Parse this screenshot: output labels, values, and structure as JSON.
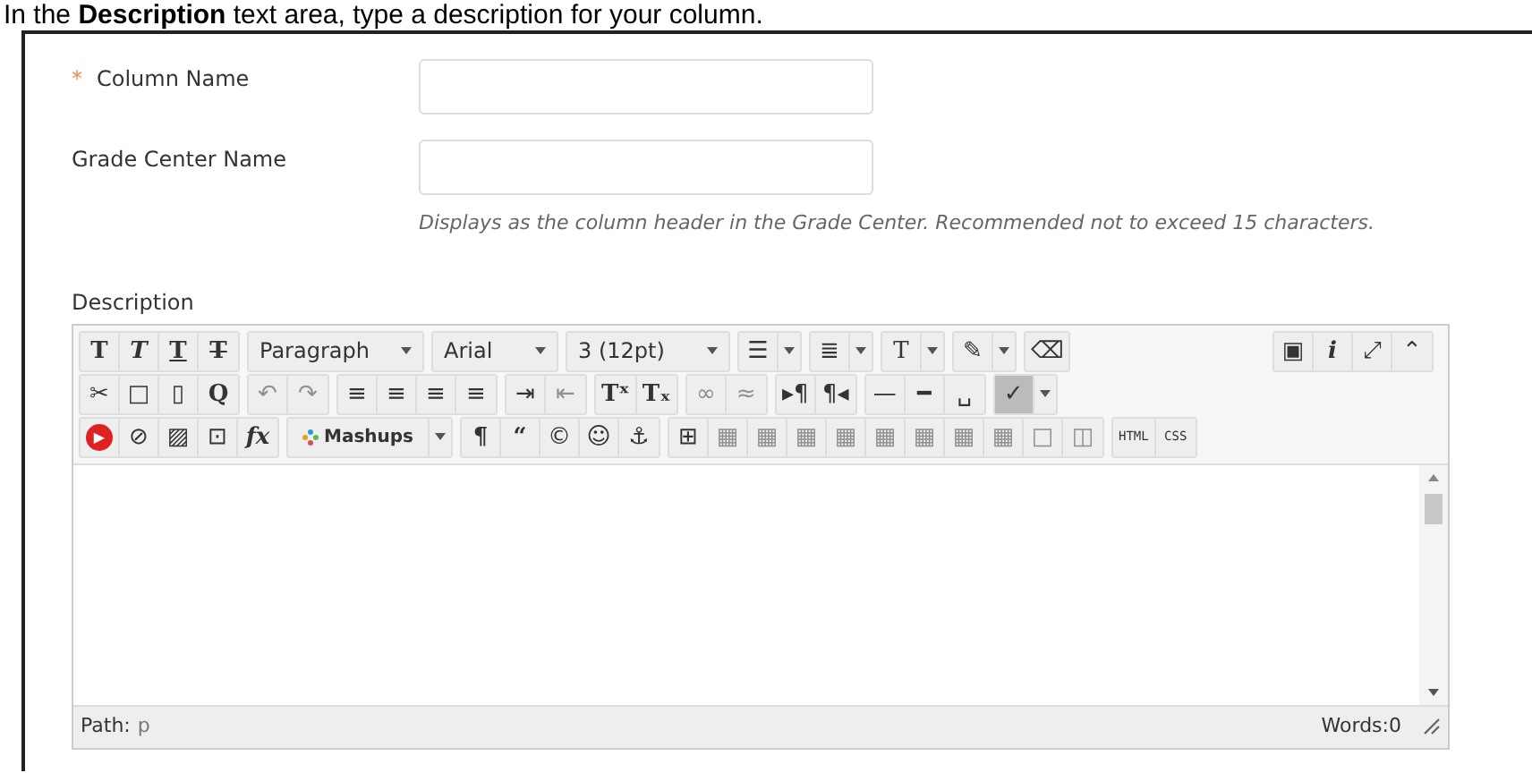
{
  "instruction": {
    "text": "In the **Description** text area, type a description for your column."
  },
  "fields": [
    {
      "marker": "*",
      "label": "Column Name"
    },
    {
      "label": "Grade Center Name",
      "hint": "Displays as the column header in the Grade Center. Recommended not to exceed 15 characters."
    }
  ],
  "description": {
    "label": "Description",
    "toolbar": [
      {
        "left": [
          [
            {
              "kind": "bold",
              "glyph": "T",
              "disabled": false
            },
            {
              "kind": "italic",
              "glyph": "T",
              "disabled": false
            },
            {
              "kind": "underline",
              "glyph": "T",
              "disabled": false
            },
            {
              "kind": "strike",
              "glyph": "T",
              "disabled": false
            }
          ],
          [
            {
              "kind": "select",
              "value": "Paragraph"
            }
          ],
          [
            {
              "kind": "select",
              "value": "Arial"
            }
          ],
          [
            {
              "kind": "select",
              "value": "3 (12pt)"
            }
          ],
          [
            {
              "kind": "split",
              "glyph": "☰",
              "disabled": false
            }
          ],
          [
            {
              "kind": "split",
              "glyph": "≣",
              "disabled": false
            }
          ],
          [
            {
              "kind": "splitserif",
              "glyph": "T",
              "disabled": false
            }
          ],
          [
            {
              "kind": "split",
              "glyph": "✎",
              "disabled": false
            }
          ],
          [
            {
              "kind": "button",
              "glyph": "⌫",
              "disabled": false
            }
          ]
        ],
        "right": [
          [
            {
              "kind": "button",
              "glyph": "▣",
              "disabled": false
            },
            {
              "kind": "italic",
              "glyph": "i",
              "disabled": false
            },
            {
              "kind": "button",
              "glyph": "⤢",
              "disabled": false
            },
            {
              "kind": "button",
              "glyph": "⌃",
              "disabled": false
            }
          ]
        ]
      },
      {
        "left": [
          [
            {
              "kind": "button",
              "glyph": "✂",
              "disabled": false
            },
            {
              "kind": "button",
              "glyph": "□",
              "disabled": false
            },
            {
              "kind": "button",
              "glyph": "▯",
              "disabled": false
            },
            {
              "kind": "bold",
              "glyph": "Q",
              "disabled": false
            }
          ],
          [
            {
              "kind": "button",
              "glyph": "↶",
              "disabled": true
            },
            {
              "kind": "button",
              "glyph": "↷",
              "disabled": true
            }
          ],
          [
            {
              "kind": "button",
              "glyph": "≡",
              "disabled": false
            },
            {
              "kind": "button",
              "glyph": "≡",
              "disabled": false
            },
            {
              "kind": "button",
              "glyph": "≡",
              "disabled": false
            },
            {
              "kind": "button",
              "glyph": "≡",
              "disabled": false
            }
          ],
          [
            {
              "kind": "button",
              "glyph": "⇥",
              "disabled": false
            },
            {
              "kind": "button",
              "glyph": "⇤",
              "disabled": true
            }
          ],
          [
            {
              "kind": "bold",
              "glyph": "Tˣ",
              "disabled": false
            },
            {
              "kind": "bold",
              "glyph": "Tₓ",
              "disabled": false
            }
          ],
          [
            {
              "kind": "button",
              "glyph": "∞",
              "disabled": true
            },
            {
              "kind": "button",
              "glyph": "≈",
              "disabled": true
            }
          ],
          [
            {
              "kind": "button",
              "glyph": "▸¶",
              "disabled": false
            },
            {
              "kind": "button",
              "glyph": "¶◂",
              "disabled": false
            }
          ],
          [
            {
              "kind": "button",
              "glyph": "—",
              "disabled": false
            },
            {
              "kind": "button",
              "glyph": "━",
              "disabled": false
            },
            {
              "kind": "button",
              "glyph": "␣",
              "disabled": false
            }
          ],
          [
            {
              "kind": "splitpressed",
              "glyph": "✓",
              "disabled": false
            }
          ]
        ]
      },
      {
        "left": [
          [
            {
              "kind": "youtube",
              "glyph": "▶",
              "disabled": false
            },
            {
              "kind": "button",
              "glyph": "⊘",
              "disabled": false
            },
            {
              "kind": "button",
              "glyph": "▨",
              "disabled": false
            },
            {
              "kind": "button",
              "glyph": "⊡",
              "disabled": false
            },
            {
              "kind": "math",
              "glyph": "fx",
              "disabled": false
            }
          ],
          [
            {
              "kind": "mashups",
              "label": "Mashups"
            }
          ],
          [
            {
              "kind": "bold",
              "glyph": "¶",
              "disabled": false
            },
            {
              "kind": "bold",
              "glyph": "“",
              "disabled": false
            },
            {
              "kind": "button",
              "glyph": "©",
              "disabled": false
            },
            {
              "kind": "button",
              "glyph": "☺",
              "disabled": false
            },
            {
              "kind": "button",
              "glyph": "⚓",
              "disabled": false
            }
          ],
          [
            {
              "kind": "button",
              "glyph": "⊞",
              "disabled": false
            },
            {
              "kind": "button",
              "glyph": "▦",
              "disabled": true
            },
            {
              "kind": "button",
              "glyph": "▦",
              "disabled": true
            },
            {
              "kind": "button",
              "glyph": "▦",
              "disabled": true
            },
            {
              "kind": "button",
              "glyph": "▦",
              "disabled": true
            },
            {
              "kind": "button",
              "glyph": "▦",
              "disabled": true
            },
            {
              "kind": "button",
              "glyph": "▦",
              "disabled": true
            },
            {
              "kind": "button",
              "glyph": "▦",
              "disabled": true
            },
            {
              "kind": "button",
              "glyph": "▦",
              "disabled": true
            },
            {
              "kind": "button",
              "glyph": "□",
              "disabled": true
            },
            {
              "kind": "button",
              "glyph": "◫",
              "disabled": true
            }
          ],
          [
            {
              "kind": "tiny",
              "glyph": "HTML",
              "disabled": false
            },
            {
              "kind": "tiny",
              "glyph": "CSS",
              "disabled": false
            }
          ]
        ]
      }
    ],
    "status": {
      "path_label": "Path:",
      "path": "p",
      "words": "Words:0"
    }
  }
}
